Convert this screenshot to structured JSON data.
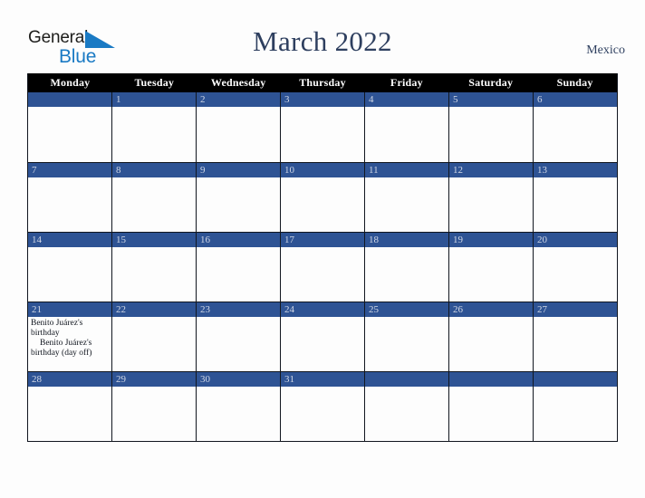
{
  "brand": {
    "name_part1": "General",
    "name_part2": "Blue",
    "triangle_color": "#1a7ac4"
  },
  "header": {
    "title": "March 2022",
    "region": "Mexico"
  },
  "theme": {
    "page_background": "#fdfdfd",
    "dow_header_background": "#000000",
    "dow_header_text": "#ffffff",
    "day_number_bar": "#2e5394",
    "day_number_text": "#d2d8e6",
    "title_text": "#2e3f5f",
    "grid_border": "#11161f"
  },
  "calendar": {
    "day_headers": [
      "Monday",
      "Tuesday",
      "Wednesday",
      "Thursday",
      "Friday",
      "Saturday",
      "Sunday"
    ],
    "weeks": [
      [
        {
          "date": "",
          "events": []
        },
        {
          "date": "1",
          "events": []
        },
        {
          "date": "2",
          "events": []
        },
        {
          "date": "3",
          "events": []
        },
        {
          "date": "4",
          "events": []
        },
        {
          "date": "5",
          "events": []
        },
        {
          "date": "6",
          "events": []
        }
      ],
      [
        {
          "date": "7",
          "events": []
        },
        {
          "date": "8",
          "events": []
        },
        {
          "date": "9",
          "events": []
        },
        {
          "date": "10",
          "events": []
        },
        {
          "date": "11",
          "events": []
        },
        {
          "date": "12",
          "events": []
        },
        {
          "date": "13",
          "events": []
        }
      ],
      [
        {
          "date": "14",
          "events": []
        },
        {
          "date": "15",
          "events": []
        },
        {
          "date": "16",
          "events": []
        },
        {
          "date": "17",
          "events": []
        },
        {
          "date": "18",
          "events": []
        },
        {
          "date": "19",
          "events": []
        },
        {
          "date": "20",
          "events": []
        }
      ],
      [
        {
          "date": "21",
          "events": [
            {
              "text": "Benito Juárez's birthday",
              "indent": false
            },
            {
              "text": "Benito Juárez's birthday (day off)",
              "indent": true
            }
          ]
        },
        {
          "date": "22",
          "events": []
        },
        {
          "date": "23",
          "events": []
        },
        {
          "date": "24",
          "events": []
        },
        {
          "date": "25",
          "events": []
        },
        {
          "date": "26",
          "events": []
        },
        {
          "date": "27",
          "events": []
        }
      ],
      [
        {
          "date": "28",
          "events": []
        },
        {
          "date": "29",
          "events": []
        },
        {
          "date": "30",
          "events": []
        },
        {
          "date": "31",
          "events": []
        },
        {
          "date": "",
          "events": []
        },
        {
          "date": "",
          "events": []
        },
        {
          "date": "",
          "events": []
        }
      ]
    ]
  }
}
